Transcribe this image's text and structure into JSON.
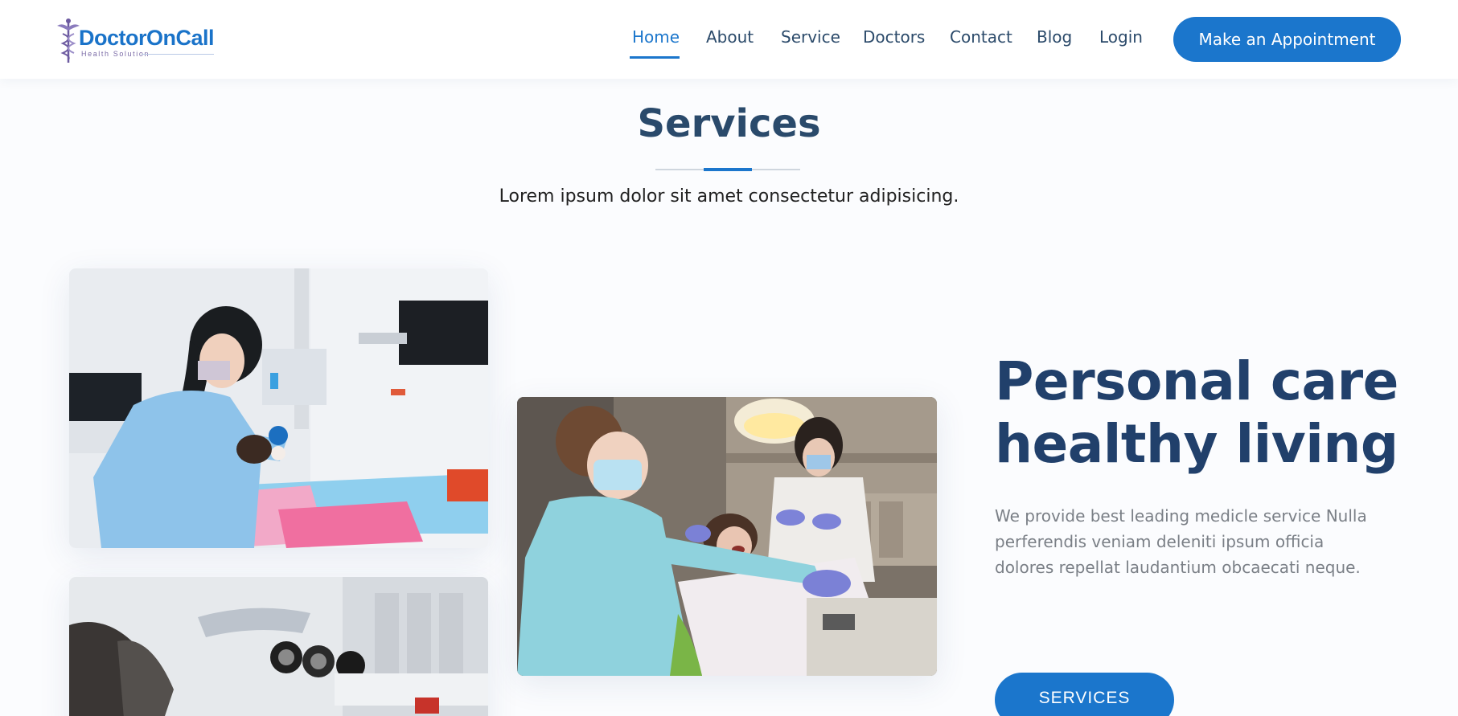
{
  "header": {
    "logo": {
      "brand": "DoctorOnCall",
      "tagline": "Health Solution",
      "icon": "caduceus-icon"
    },
    "nav": [
      {
        "label": "Home",
        "active": true
      },
      {
        "label": "About",
        "active": false
      },
      {
        "label": "Service",
        "active": false
      },
      {
        "label": "Doctors",
        "active": false
      },
      {
        "label": "Contact",
        "active": false
      },
      {
        "label": "Blog",
        "active": false
      },
      {
        "label": "Login",
        "active": false
      }
    ],
    "cta_label": "Make an Appointment"
  },
  "section": {
    "title": "Services",
    "subtitle": "Lorem ipsum dolor sit amet consectetur adipisicing."
  },
  "hero": {
    "title_line1": "Personal care",
    "title_line2": "healthy living",
    "description": "We provide best leading medicle service Nulla perferendis veniam deleniti ipsum officia dolores repellat laudantium obcaecati neque.",
    "button_label": "SERVICES"
  },
  "colors": {
    "primary": "#1b76cc",
    "heading": "#21406b",
    "nav_text": "#2b4a6a",
    "muted_text": "#7a7f86"
  }
}
